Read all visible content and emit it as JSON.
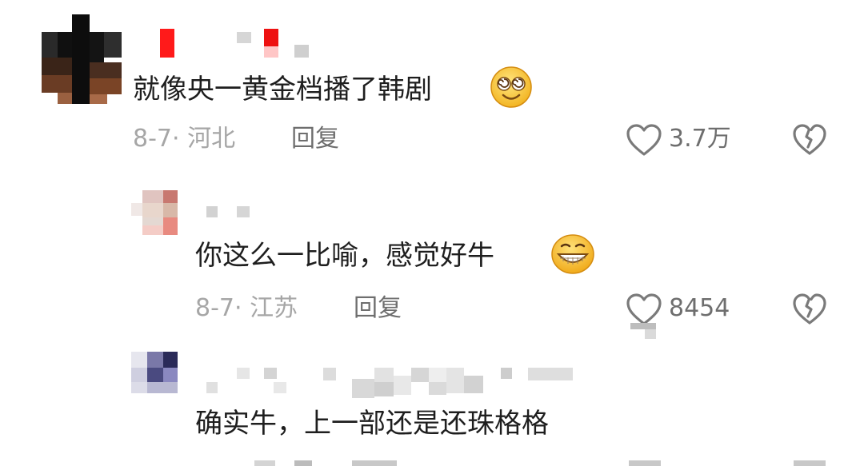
{
  "comments": [
    {
      "text": "就像央一黄金档播了韩剧",
      "date_location": "8-7· 河北",
      "reply_label": "回复",
      "like_count": "3.7万",
      "emoji": "dizzy-smiley"
    },
    {
      "text": "你这么一比喻，感觉好牛",
      "date_location": "8-7· 江苏",
      "reply_label": "回复",
      "like_count": "8454",
      "emoji": "grin-smiley"
    },
    {
      "text": "确实牛，上一部还是还珠格格",
      "date_location": "",
      "reply_label": "",
      "like_count": ""
    }
  ],
  "icons": {
    "like": "heart-outline-icon",
    "dislike": "broken-heart-icon"
  },
  "colors": {
    "text": "#1e1e1e",
    "meta": "#a6a6a6",
    "secondary": "#6e6e6e",
    "icon": "#7a7a7a"
  }
}
